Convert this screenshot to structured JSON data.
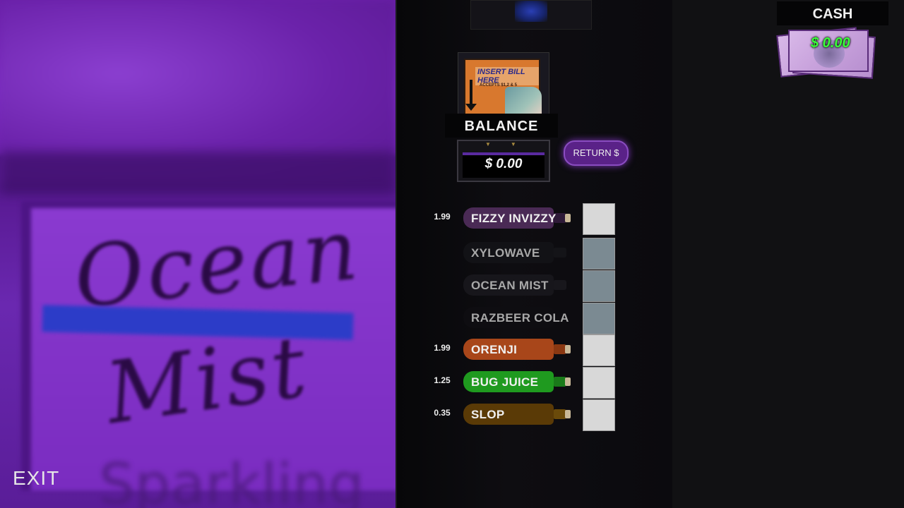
{
  "poster": {
    "word1": "Ocean",
    "word2": "Mist",
    "word3": "Sparkling"
  },
  "exit_label": "EXIT",
  "bill_acceptor": {
    "title": "INSERT BILL HERE",
    "accepts": "ACCEPTS $1,2 & 5"
  },
  "balance": {
    "label": "BALANCE",
    "value": "$ 0.00"
  },
  "return_label": "RETURN $",
  "cash": {
    "label": "CASH",
    "value": "$ 0.00"
  },
  "products": [
    {
      "name": "FIZZY INVIZZY",
      "price": "1.99",
      "available": true,
      "bottle_color": "#4a2a55",
      "neck_color": "#2e1a38"
    },
    {
      "name": "XYLOWAVE",
      "price": "",
      "available": false,
      "bottle_color": "#121216",
      "neck_color": "#141418"
    },
    {
      "name": "OCEAN MIST",
      "price": "",
      "available": false,
      "bottle_color": "#17161b",
      "neck_color": "#18171c"
    },
    {
      "name": "RAZBEER COLA",
      "price": "",
      "available": false,
      "bottle_color": "#0e0d11",
      "neck_color": "#0e0d11"
    },
    {
      "name": "ORENJI",
      "price": "1.99",
      "available": true,
      "bottle_color": "#a8461a",
      "neck_color": "#8a3812"
    },
    {
      "name": "BUG JUICE",
      "price": "1.25",
      "available": true,
      "bottle_color": "#1f9a1f",
      "neck_color": "#1a7a1a"
    },
    {
      "name": "SLOP",
      "price": "0.35",
      "available": true,
      "bottle_color": "#5a3a06",
      "neck_color": "#6a4a0a"
    }
  ]
}
